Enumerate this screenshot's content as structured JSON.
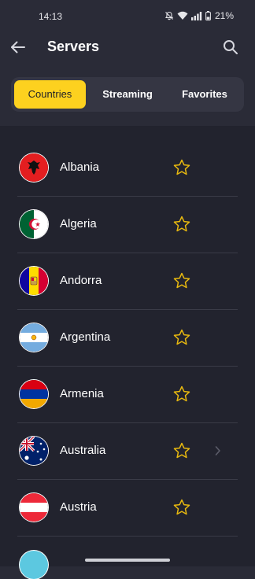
{
  "status_bar": {
    "time": "14:13",
    "battery": "21%",
    "icons": [
      "bell-off-icon",
      "wifi-icon",
      "signal-icon",
      "battery-icon"
    ]
  },
  "header": {
    "title": "Servers",
    "back_icon": "arrow-left-icon",
    "search_icon": "search-icon"
  },
  "tabs": {
    "items": [
      {
        "label": "Countries",
        "active": true
      },
      {
        "label": "Streaming",
        "active": false
      },
      {
        "label": "Favorites",
        "active": false
      }
    ]
  },
  "servers": {
    "items": [
      {
        "name": "Albania",
        "flag": "albania-flag",
        "favorite": false
      },
      {
        "name": "Algeria",
        "flag": "algeria-flag",
        "favorite": false
      },
      {
        "name": "Andorra",
        "flag": "andorra-flag",
        "favorite": false
      },
      {
        "name": "Argentina",
        "flag": "argentina-flag",
        "favorite": false
      },
      {
        "name": "Armenia",
        "flag": "armenia-flag",
        "favorite": false
      },
      {
        "name": "Australia",
        "flag": "australia-flag",
        "favorite": false,
        "expandable": true
      },
      {
        "name": "Austria",
        "flag": "austria-flag",
        "favorite": false
      }
    ]
  },
  "colors": {
    "accent": "#fdd11f",
    "background": "#2a2b37",
    "list_background": "#22232e",
    "star": "#e8b90f"
  }
}
